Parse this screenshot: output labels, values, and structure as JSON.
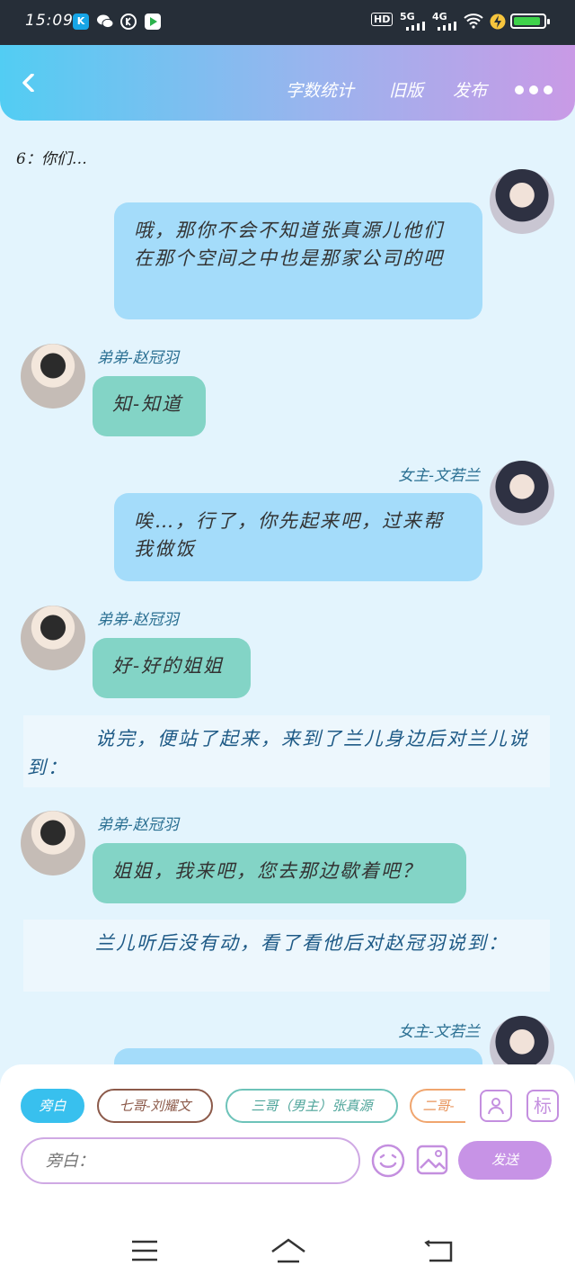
{
  "status_bar": {
    "time": "15:09",
    "network_hd": "HD",
    "network_5g": "5G",
    "network_4g": "4G",
    "battery_level": 0.9,
    "battery_color": "#3ed24a",
    "icons": [
      "kuai-app-icon",
      "wechat-icon",
      "k-circle-icon",
      "video-app-icon",
      "signal-icon",
      "wifi-icon",
      "charging-icon",
      "battery-icon"
    ]
  },
  "header": {
    "word_count": "字数统计",
    "old_version": "旧版",
    "publish": "发布"
  },
  "chat": {
    "top_line": "6：你们…",
    "messages": [
      {
        "type": "female",
        "speaker": "",
        "text": "哦，那你不会不知道张真源儿他们在那个空间之中也是那家公司的吧"
      },
      {
        "type": "male",
        "speaker": "弟弟-赵冠羽",
        "text": "知-知道"
      },
      {
        "type": "female",
        "speaker": "女主-文若兰",
        "text": "唉…，行了，你先起来吧，过来帮我做饭"
      },
      {
        "type": "male",
        "speaker": "弟弟-赵冠羽",
        "text": "好-好的姐姐"
      },
      {
        "type": "narration",
        "text": "说完，便站了起来，来到了兰儿身边后对兰儿说到："
      },
      {
        "type": "male",
        "speaker": "弟弟-赵冠羽",
        "text": "姐姐，我来吧，您去那边歇着吧？"
      },
      {
        "type": "narration",
        "text": "兰儿听后没有动，看了看他后对赵冠羽说到："
      },
      {
        "type": "female",
        "speaker": "女主-文若兰",
        "text": ""
      }
    ]
  },
  "composer": {
    "roles": [
      {
        "label": "旁白",
        "color": "#38c0ee",
        "active": true
      },
      {
        "label": "七哥-刘耀文",
        "color": "#8c5a4a",
        "active": false
      },
      {
        "label": "三哥（男主）张真源",
        "color": "#6dc3b9",
        "active": false
      },
      {
        "label": "二哥-",
        "color": "#f0a56e",
        "active": false
      }
    ],
    "placeholder": "旁白：",
    "send": "发送",
    "tag_icon_text": "标"
  },
  "colors": {
    "header_start": "#52cdf3",
    "header_end": "#c99ae6",
    "bubble_female": "#a4dcfa",
    "bubble_male": "#83d4c6",
    "speaker": "#2a6f92",
    "narration": "#1e5a86",
    "send_button": "#c793e6"
  }
}
